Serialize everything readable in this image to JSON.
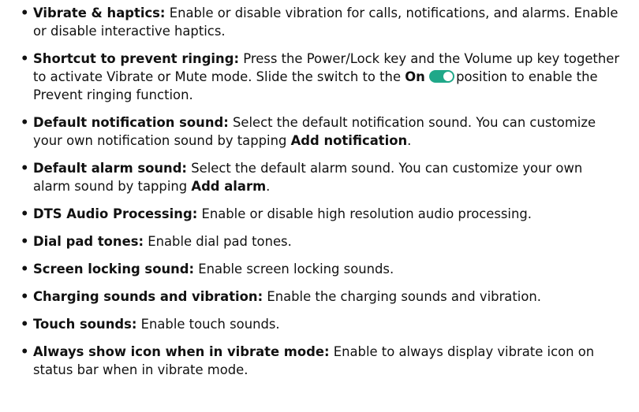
{
  "items": [
    {
      "term": "Vibrate & haptics:",
      "text": "Enable or disable vibration for calls, notifications, and alarms. Enable or disable interactive haptics."
    },
    {
      "term": "Shortcut to prevent ringing:",
      "text_a": "Press the Power/Lock key and the Volume up key together to activate Vibrate or Mute mode. Slide the switch to the",
      "bold_a": "On",
      "toggle_state": "on",
      "toggle_color": "#20a889",
      "text_b": "position to enable the Prevent ringing function."
    },
    {
      "term": "Default notification sound:",
      "text": "Select the default notification sound. You can customize your own notification sound by tapping",
      "bold_end": "Add notification",
      "tail": "."
    },
    {
      "term": "Default alarm sound:",
      "text": "Select the default alarm sound. You can customize your own alarm sound by tapping",
      "bold_end": "Add alarm",
      "tail": "."
    },
    {
      "term": "DTS Audio Processing:",
      "text": "Enable or disable high resolution audio processing."
    },
    {
      "term": "Dial pad tones:",
      "text": "Enable dial pad tones."
    },
    {
      "term": "Screen locking sound:",
      "text": "Enable screen locking sounds."
    },
    {
      "term": "Charging sounds and vibration:",
      "text": "Enable the charging sounds and vibration."
    },
    {
      "term": "Touch sounds:",
      "text": "Enable touch sounds."
    },
    {
      "term": "Always show icon when in vibrate mode:",
      "text": "Enable to always display vibrate icon on status bar when in vibrate mode."
    }
  ],
  "bullet": "•"
}
